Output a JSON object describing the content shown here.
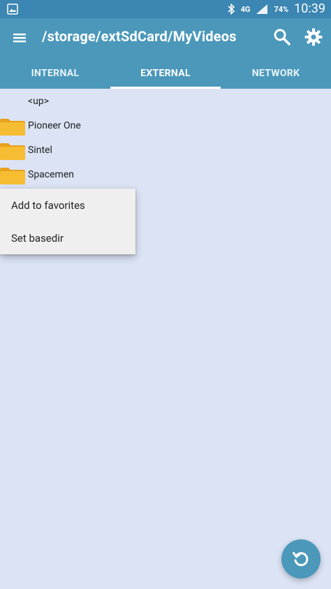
{
  "statusbar": {
    "network_type": "4G",
    "battery": "74%",
    "time": "10:39"
  },
  "toolbar": {
    "path": "/storage/extSdCard/MyVideos"
  },
  "tabs": [
    {
      "label": "INTERNAL"
    },
    {
      "label": "EXTERNAL"
    },
    {
      "label": "NETWORK"
    }
  ],
  "list": {
    "up_label": "<up>",
    "items": [
      {
        "label": "Pioneer One",
        "icon": "folder-icon"
      },
      {
        "label": "Sintel",
        "icon": "folder-icon"
      },
      {
        "label": "Spacemen",
        "icon": "folder-icon"
      }
    ]
  },
  "context_menu": {
    "items": [
      {
        "label": "Add to favorites"
      },
      {
        "label": "Set basedir"
      }
    ]
  },
  "colors": {
    "primary": "#4b98bb",
    "statusbar": "#3b86b2",
    "background": "#dbe3f4",
    "folder": "#f3b52b"
  }
}
